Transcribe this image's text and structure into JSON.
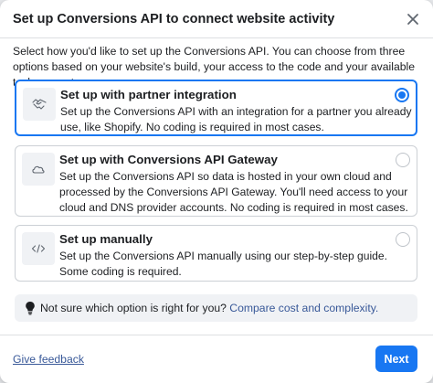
{
  "dialog": {
    "title": "Set up Conversions API to connect website activity",
    "intro": "Select how you'd like to set up the Conversions API. You can choose from three options based on your website's build, your access to the code and your available tech support."
  },
  "options": [
    {
      "title": "Set up with partner integration",
      "description": "Set up the Conversions API with an integration for a partner you already use, like Shopify. No coding is required in most cases.",
      "icon": "handshake-icon",
      "selected": true
    },
    {
      "title": "Set up with Conversions API Gateway",
      "description": "Set up the Conversions API so data is hosted in your own cloud and processed by the Conversions API Gateway. You'll need access to your cloud and DNS provider accounts. No coding is required in most cases.",
      "icon": "cloud-icon",
      "selected": false
    },
    {
      "title": "Set up manually",
      "description": "Set up the Conversions API manually using our step-by-step guide. Some coding is required.",
      "icon": "code-icon",
      "selected": false
    }
  ],
  "hint": {
    "text": "Not sure which option is right for you?",
    "link": "Compare cost and complexity."
  },
  "footer": {
    "feedback": "Give feedback",
    "next": "Next"
  },
  "colors": {
    "accent": "#1877f2",
    "link": "#385898"
  }
}
